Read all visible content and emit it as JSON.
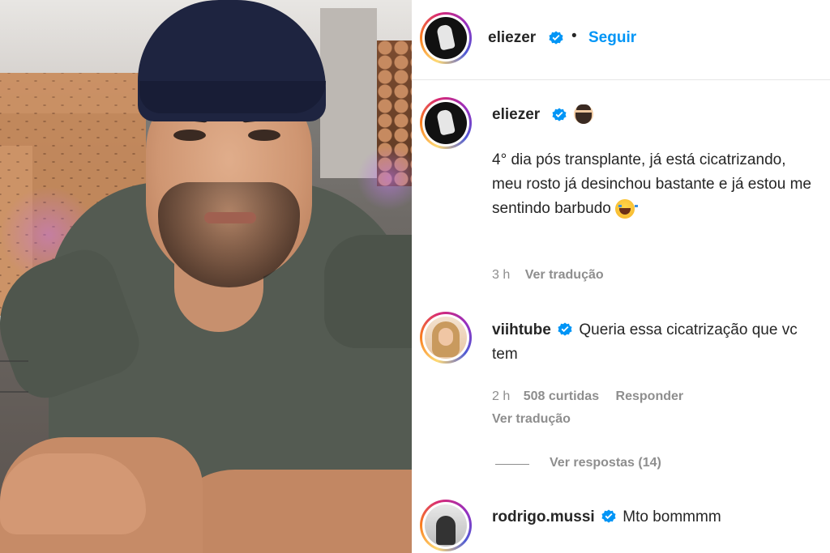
{
  "post": {
    "author": "eliezer",
    "follow_separator": "•",
    "follow_label": "Seguir"
  },
  "caption": {
    "author": "eliezer",
    "text": "4° dia pós transplante, já está cicatrizando, meu rosto já desinchou bastante e já estou me sentindo barbudo",
    "time": "3 h",
    "translate_label": "Ver tradução"
  },
  "comments": [
    {
      "author": "viihtube",
      "text": "Queria essa cicatrização que vc tem",
      "time": "2 h",
      "likes": "508 curtidas",
      "reply_label": "Responder",
      "translate_label": "Ver tradução",
      "view_replies": "Ver respostas (14)"
    },
    {
      "author": "rodrigo.mussi",
      "text": "Mto bommmm"
    }
  ],
  "icons": {
    "verified": "verified-badge-icon",
    "beard_emoji": "bearded-person-emoji-icon",
    "laugh_emoji": "tears-of-joy-emoji-icon"
  },
  "colors": {
    "link": "#0095f6",
    "verified": "#0095f6",
    "muted": "#8e8e8e",
    "text": "#262626"
  }
}
